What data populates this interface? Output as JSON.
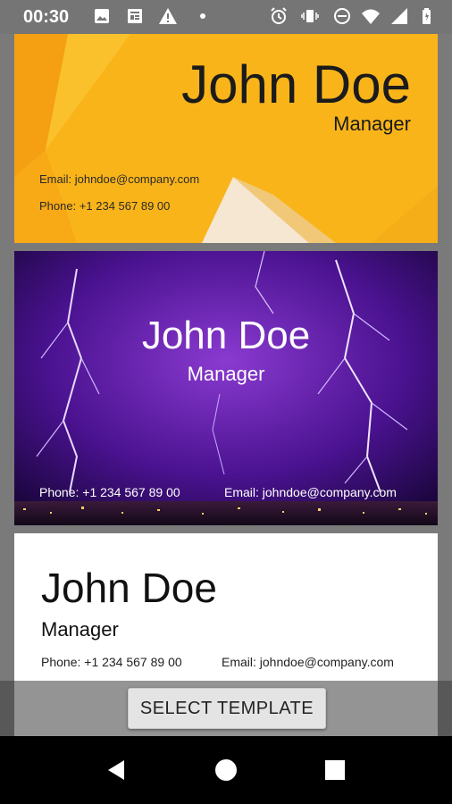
{
  "status_bar": {
    "time": "00:30",
    "icons": [
      "image-icon",
      "news-icon",
      "warning-icon",
      "dot-icon",
      "alarm-icon",
      "vibrate-icon",
      "dnd-icon",
      "wifi-icon",
      "signal-icon",
      "battery-icon"
    ]
  },
  "cards": [
    {
      "template": "yellow",
      "name": "John Doe",
      "title": "Manager",
      "email": "Email: johndoe@company.com",
      "phone": "Phone: +1 234 567 89 00",
      "background_color": "#f9b41a"
    },
    {
      "template": "purple-lightning",
      "name": "John Doe",
      "title": "Manager",
      "phone": "Phone: +1 234 567 89 00",
      "email": "Email: johndoe@company.com",
      "background_color": "#3a0a6a"
    },
    {
      "template": "white",
      "name": "John Doe",
      "title": "Manager",
      "phone": "Phone: +1 234 567 89 00",
      "email": "Email: johndoe@company.com",
      "background_color": "#ffffff"
    }
  ],
  "select_button": {
    "label": "SELECT TEMPLATE"
  },
  "nav_bar": {
    "icons": [
      "back-icon",
      "home-icon",
      "recents-icon"
    ]
  }
}
